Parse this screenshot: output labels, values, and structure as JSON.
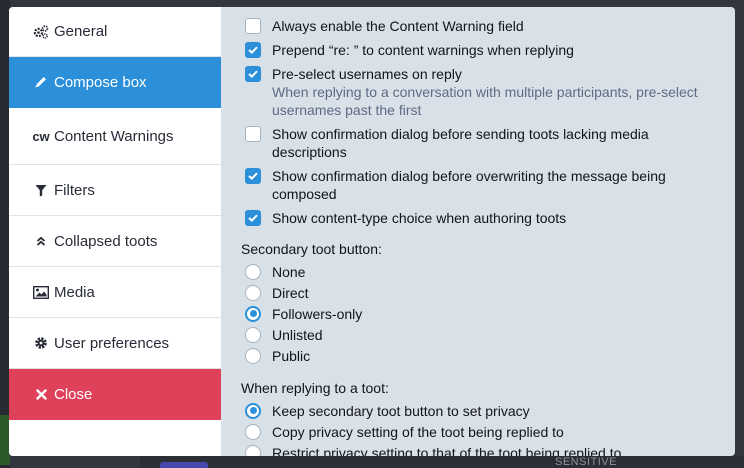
{
  "nav": {
    "general": "General",
    "compose": "Compose box",
    "content_warnings": "Content Warnings",
    "cw_glyph": "cw",
    "filters": "Filters",
    "collapsed": "Collapsed toots",
    "media": "Media",
    "user_prefs": "User preferences",
    "close": "Close"
  },
  "options": [
    {
      "label": "Always enable the Content Warning field",
      "checked": false
    },
    {
      "label": "Prepend “re: ” to content warnings when replying",
      "checked": true
    },
    {
      "label": "Pre-select usernames on reply",
      "hint": "When replying to a conversation with multiple participants, pre-select usernames past the first",
      "checked": true
    },
    {
      "label": "Show confirmation dialog before sending toots lacking media descriptions",
      "checked": false
    },
    {
      "label": "Show confirmation dialog before overwriting the message being composed",
      "checked": true
    },
    {
      "label": "Show content-type choice when authoring toots",
      "checked": true
    }
  ],
  "secondary": {
    "label": "Secondary toot button:",
    "options": [
      "None",
      "Direct",
      "Followers-only",
      "Unlisted",
      "Public"
    ],
    "selected": "Followers-only"
  },
  "replying": {
    "label": "When replying to a toot:",
    "options": [
      "Keep secondary toot button to set privacy",
      "Copy privacy setting of the toot being replied to",
      "Restrict privacy setting to that of the toot being replied to"
    ],
    "selected": "Keep secondary toot button to set privacy"
  },
  "background": {
    "sensitive_label": "SENSITIVE"
  },
  "colors": {
    "accent": "#2b90d9",
    "danger": "#df405a",
    "panel": "#d9e1e8"
  }
}
